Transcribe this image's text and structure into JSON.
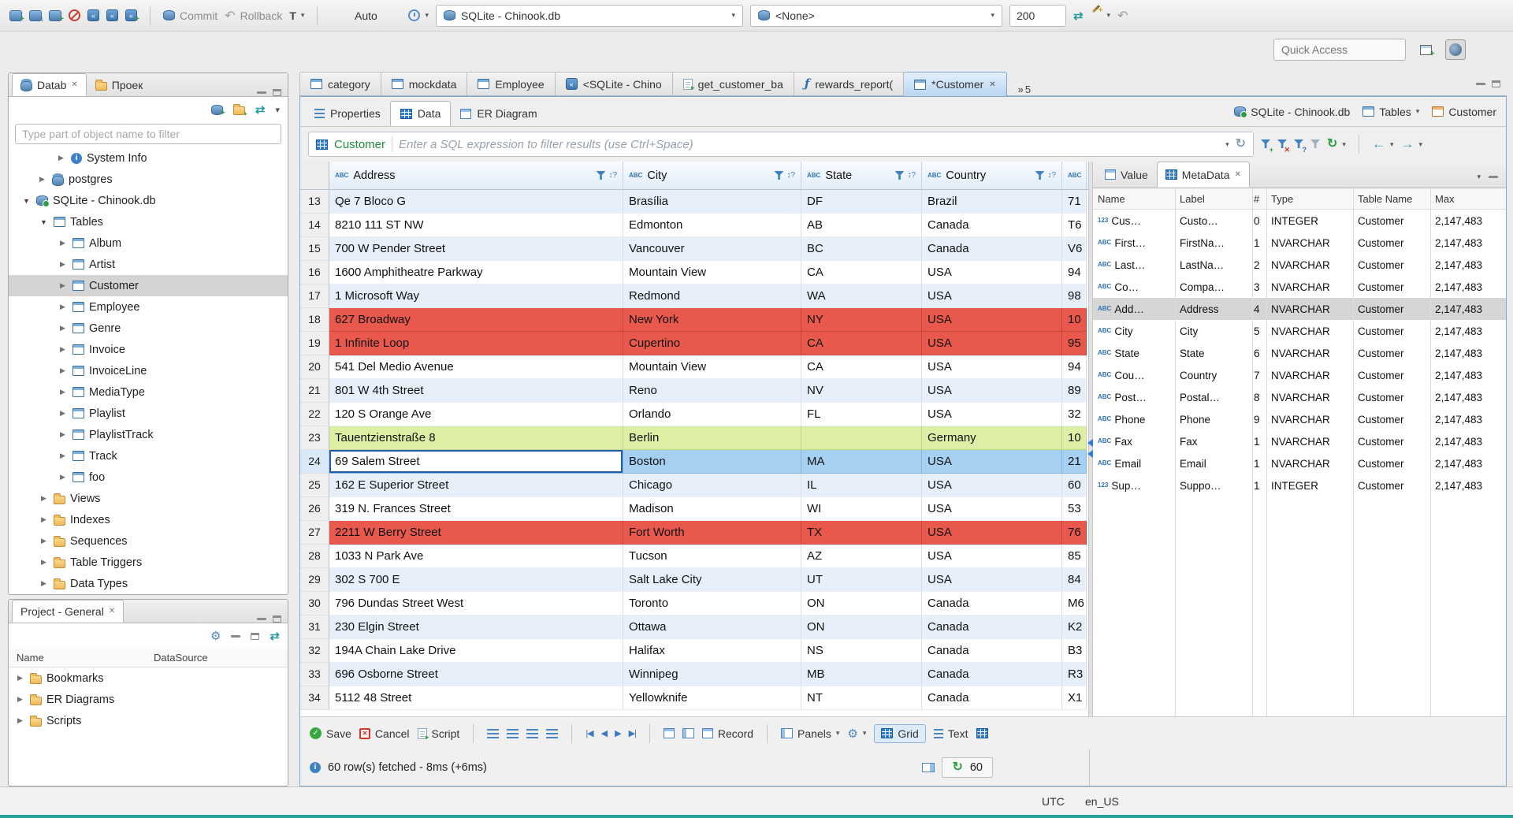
{
  "window": {
    "statusbar": {
      "tz": "UTC",
      "locale": "en_US"
    }
  },
  "icons": {
    "text_type": "ABC",
    "numeric_type": "123",
    "sort_indicator": "↕?",
    "refresh_glyph": "↻"
  },
  "main_toolbar": {
    "commit": "Commit",
    "rollback": "Rollback",
    "txn_mode": "T",
    "auto": "Auto",
    "database": "SQLite - Chinook.db",
    "schema": "<None>",
    "fetch_size": "200",
    "quick_access": "Quick Access"
  },
  "editor_tabs": {
    "tabs": [
      {
        "label": "category",
        "icon": "table"
      },
      {
        "label": "mockdata",
        "icon": "table"
      },
      {
        "label": "Employee",
        "icon": "table"
      },
      {
        "label": "<SQLite - Chino",
        "icon": "sql"
      },
      {
        "label": "get_customer_ba",
        "icon": "script"
      },
      {
        "label": "rewards_report(",
        "icon": "function"
      },
      {
        "label": "*Customer",
        "icon": "table",
        "active": true
      }
    ],
    "overflow_count": "5"
  },
  "navigator": {
    "tab1": "Datab",
    "tab2": "Проек",
    "filter_placeholder": "Type part of object name to filter",
    "tree": [
      {
        "label": "System Info",
        "indent": 60,
        "arrow": "r",
        "icon": "info"
      },
      {
        "label": "postgres",
        "indent": 36,
        "arrow": "r",
        "icon": "dbstack"
      },
      {
        "label": "SQLite - Chinook.db",
        "indent": 16,
        "arrow": "d",
        "icon": "dbok"
      },
      {
        "label": "Tables",
        "indent": 38,
        "arrow": "d",
        "icon": "tables"
      },
      {
        "label": "Album",
        "indent": 62,
        "arrow": "r",
        "icon": "table"
      },
      {
        "label": "Artist",
        "indent": 62,
        "arrow": "r",
        "icon": "table"
      },
      {
        "label": "Customer",
        "indent": 62,
        "arrow": "r",
        "icon": "table",
        "selected": true
      },
      {
        "label": "Employee",
        "indent": 62,
        "arrow": "r",
        "icon": "table"
      },
      {
        "label": "Genre",
        "indent": 62,
        "arrow": "r",
        "icon": "table"
      },
      {
        "label": "Invoice",
        "indent": 62,
        "arrow": "r",
        "icon": "table"
      },
      {
        "label": "InvoiceLine",
        "indent": 62,
        "arrow": "r",
        "icon": "table"
      },
      {
        "label": "MediaType",
        "indent": 62,
        "arrow": "r",
        "icon": "table"
      },
      {
        "label": "Playlist",
        "indent": 62,
        "arrow": "r",
        "icon": "table"
      },
      {
        "label": "PlaylistTrack",
        "indent": 62,
        "arrow": "r",
        "icon": "table"
      },
      {
        "label": "Track",
        "indent": 62,
        "arrow": "r",
        "icon": "table"
      },
      {
        "label": "foo",
        "indent": 62,
        "arrow": "r",
        "icon": "table"
      },
      {
        "label": "Views",
        "indent": 38,
        "arrow": "r",
        "icon": "folder"
      },
      {
        "label": "Indexes",
        "indent": 38,
        "arrow": "r",
        "icon": "folder"
      },
      {
        "label": "Sequences",
        "indent": 38,
        "arrow": "r",
        "icon": "folder"
      },
      {
        "label": "Table Triggers",
        "indent": 38,
        "arrow": "r",
        "icon": "folder"
      },
      {
        "label": "Data Types",
        "indent": 38,
        "arrow": "r",
        "icon": "folder"
      }
    ]
  },
  "project_panel": {
    "title": "Project - General",
    "columns": [
      "Name",
      "DataSource"
    ],
    "items": [
      {
        "label": "Bookmarks",
        "icon": "folder"
      },
      {
        "label": "ER Diagrams",
        "icon": "folder-er"
      },
      {
        "label": "Scripts",
        "icon": "folder"
      }
    ]
  },
  "editor": {
    "result_tabs": [
      "Properties",
      "Data",
      "ER Diagram"
    ],
    "breadcrumb": {
      "db": "SQLite - Chinook.db",
      "container": "Tables",
      "entity": "Customer"
    },
    "filter": {
      "entity": "Customer",
      "placeholder": "Enter a SQL expression to filter results (use Ctrl+Space)"
    }
  },
  "grid": {
    "columns": [
      "Address",
      "City",
      "State",
      "Country"
    ],
    "rows": [
      {
        "n": "13",
        "hl": "stripe",
        "cells": [
          "Qe 7 Bloco G",
          "Brasília",
          "DF",
          "Brazil",
          "71"
        ]
      },
      {
        "n": "14",
        "hl": "",
        "cells": [
          "8210 111 ST NW",
          "Edmonton",
          "AB",
          "Canada",
          "T6"
        ]
      },
      {
        "n": "15",
        "hl": "stripe",
        "cells": [
          "700 W Pender Street",
          "Vancouver",
          "BC",
          "Canada",
          "V6"
        ]
      },
      {
        "n": "16",
        "hl": "",
        "cells": [
          "1600 Amphitheatre Parkway",
          "Mountain View",
          "CA",
          "USA",
          "94"
        ]
      },
      {
        "n": "17",
        "hl": "stripe",
        "cells": [
          "1 Microsoft Way",
          "Redmond",
          "WA",
          "USA",
          "98"
        ]
      },
      {
        "n": "18",
        "hl": "red",
        "cells": [
          "627 Broadway",
          "New York",
          "NY",
          "USA",
          "10"
        ]
      },
      {
        "n": "19",
        "hl": "red",
        "cells": [
          "1 Infinite Loop",
          "Cupertino",
          "CA",
          "USA",
          "95"
        ]
      },
      {
        "n": "20",
        "hl": "",
        "cells": [
          "541 Del Medio Avenue",
          "Mountain View",
          "CA",
          "USA",
          "94"
        ]
      },
      {
        "n": "21",
        "hl": "stripe",
        "cells": [
          "801 W 4th Street",
          "Reno",
          "NV",
          "USA",
          "89"
        ]
      },
      {
        "n": "22",
        "hl": "",
        "cells": [
          "120 S Orange Ave",
          "Orlando",
          "FL",
          "USA",
          "32"
        ]
      },
      {
        "n": "23",
        "hl": "green",
        "cells": [
          "Tauentzienstraße 8",
          "Berlin",
          "",
          "Germany",
          "10"
        ]
      },
      {
        "n": "24",
        "hl": "sel",
        "cells": [
          "69 Salem Street",
          "Boston",
          "MA",
          "USA",
          "21"
        ]
      },
      {
        "n": "25",
        "hl": "stripe",
        "cells": [
          "162 E Superior Street",
          "Chicago",
          "IL",
          "USA",
          "60"
        ]
      },
      {
        "n": "26",
        "hl": "",
        "cells": [
          "319 N. Frances Street",
          "Madison",
          "WI",
          "USA",
          "53"
        ]
      },
      {
        "n": "27",
        "hl": "red",
        "cells": [
          "2211 W Berry Street",
          "Fort Worth",
          "TX",
          "USA",
          "76"
        ]
      },
      {
        "n": "28",
        "hl": "",
        "cells": [
          "1033 N Park Ave",
          "Tucson",
          "AZ",
          "USA",
          "85"
        ]
      },
      {
        "n": "29",
        "hl": "stripe",
        "cells": [
          "302 S 700 E",
          "Salt Lake City",
          "UT",
          "USA",
          "84"
        ]
      },
      {
        "n": "30",
        "hl": "",
        "cells": [
          "796 Dundas Street West",
          "Toronto",
          "ON",
          "Canada",
          "M6"
        ]
      },
      {
        "n": "31",
        "hl": "stripe",
        "cells": [
          "230 Elgin Street",
          "Ottawa",
          "ON",
          "Canada",
          "K2"
        ]
      },
      {
        "n": "32",
        "hl": "",
        "cells": [
          "194A Chain Lake Drive",
          "Halifax",
          "NS",
          "Canada",
          "B3"
        ]
      },
      {
        "n": "33",
        "hl": "stripe",
        "cells": [
          "696 Osborne Street",
          "Winnipeg",
          "MB",
          "Canada",
          "R3"
        ]
      },
      {
        "n": "34",
        "hl": "",
        "cells": [
          "5112 48 Street",
          "Yellowknife",
          "NT",
          "Canada",
          "X1"
        ]
      }
    ]
  },
  "value_panel": {
    "tabs": [
      "Value",
      "MetaData"
    ],
    "metadata": {
      "columns": [
        "Name",
        "Label",
        "#",
        "Type",
        "Table Name",
        "Max"
      ],
      "rows": [
        {
          "t": "123",
          "cells": [
            "Cus…",
            "Custo…",
            "0",
            "INTEGER",
            "Customer",
            "2,147,483"
          ]
        },
        {
          "t": "abc",
          "cells": [
            "First…",
            "FirstNa…",
            "1",
            "NVARCHAR",
            "Customer",
            "2,147,483"
          ]
        },
        {
          "t": "abc",
          "cells": [
            "Last…",
            "LastNa…",
            "2",
            "NVARCHAR",
            "Customer",
            "2,147,483"
          ]
        },
        {
          "t": "abc",
          "cells": [
            "Co…",
            "Compa…",
            "3",
            "NVARCHAR",
            "Customer",
            "2,147,483"
          ]
        },
        {
          "t": "abc",
          "cells": [
            "Add…",
            "Address",
            "4",
            "NVARCHAR",
            "Customer",
            "2,147,483"
          ],
          "sel": true
        },
        {
          "t": "abc",
          "cells": [
            "City",
            "City",
            "5",
            "NVARCHAR",
            "Customer",
            "2,147,483"
          ]
        },
        {
          "t": "abc",
          "cells": [
            "State",
            "State",
            "6",
            "NVARCHAR",
            "Customer",
            "2,147,483"
          ]
        },
        {
          "t": "abc",
          "cells": [
            "Cou…",
            "Country",
            "7",
            "NVARCHAR",
            "Customer",
            "2,147,483"
          ]
        },
        {
          "t": "abc",
          "cells": [
            "Post…",
            "Postal…",
            "8",
            "NVARCHAR",
            "Customer",
            "2,147,483"
          ]
        },
        {
          "t": "abc",
          "cells": [
            "Phone",
            "Phone",
            "9",
            "NVARCHAR",
            "Customer",
            "2,147,483"
          ]
        },
        {
          "t": "abc",
          "cells": [
            "Fax",
            "Fax",
            "1",
            "NVARCHAR",
            "Customer",
            "2,147,483"
          ]
        },
        {
          "t": "abc",
          "cells": [
            "Email",
            "Email",
            "1",
            "NVARCHAR",
            "Customer",
            "2,147,483"
          ]
        },
        {
          "t": "123",
          "cells": [
            "Sup…",
            "Suppo…",
            "1",
            "INTEGER",
            "Customer",
            "2,147,483"
          ]
        }
      ]
    }
  },
  "bottom_toolbar": {
    "save": "Save",
    "cancel": "Cancel",
    "script": "Script",
    "record": "Record",
    "panels": "Panels",
    "grid": "Grid",
    "text": "Text"
  },
  "status": {
    "fetch": "60 row(s) fetched - 8ms (+6ms)",
    "refresh_count": "60"
  }
}
